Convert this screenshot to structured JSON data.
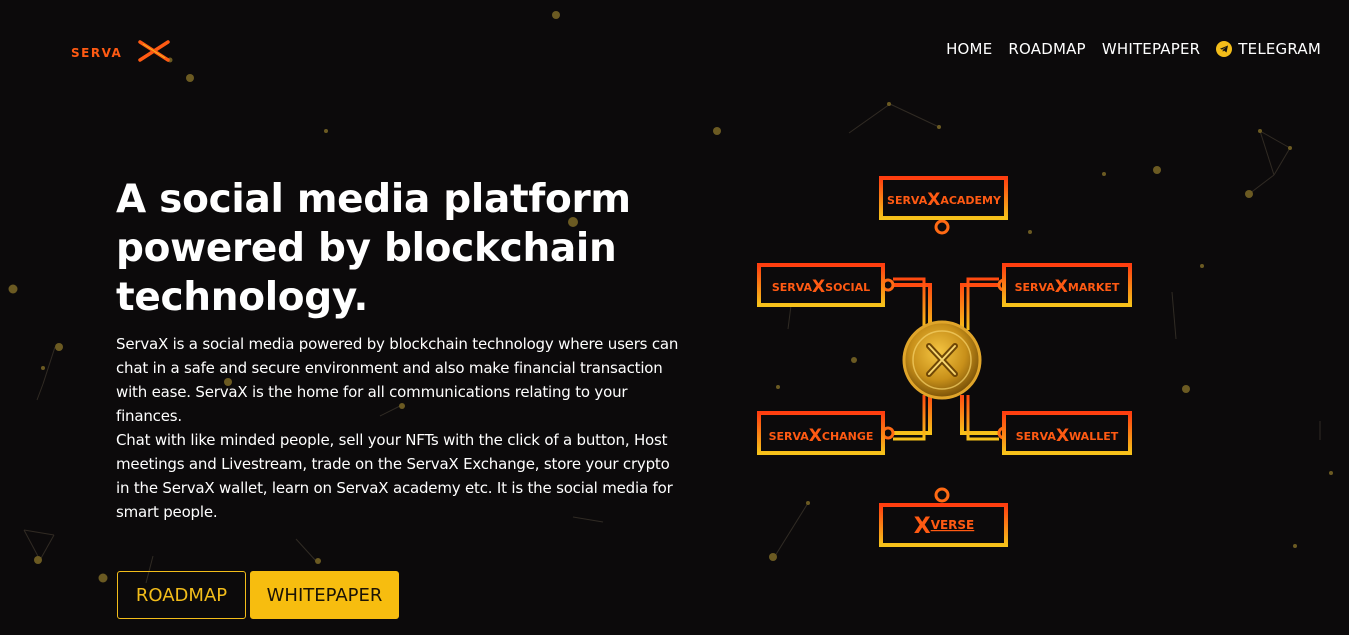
{
  "header": {
    "logo_text": "SERVAX",
    "nav": [
      {
        "label": "HOME"
      },
      {
        "label": "ROADMAP"
      },
      {
        "label": "WHITEPAPER"
      },
      {
        "label": "TELEGRAM",
        "icon": "telegram-icon"
      }
    ]
  },
  "hero": {
    "title": "A social media platform powered by blockchain technology.",
    "paragraph1": "ServaX is a social media powered by blockchain technology where users can chat in a safe and secure environment and also make financial transaction with ease. ServaX is the home for all communications relating to your finances.",
    "paragraph2": "Chat with like minded people, sell your NFTs with the click of a button, Host meetings and Livestream, trade on the ServaX Exchange, store your crypto in the ServaX wallet, learn on ServaX academy etc. It is the social media for smart people.",
    "buttons": {
      "roadmap": "ROADMAP",
      "whitepaper": "WHITEPAPER"
    }
  },
  "ecosystem": {
    "center_icon": "servax-coin-icon",
    "nodes": [
      {
        "prefix": "SERVA",
        "x": "X",
        "suffix": "ACADEMY"
      },
      {
        "prefix": "SERVA",
        "x": "X",
        "suffix": "SOCIAL"
      },
      {
        "prefix": "SERVA",
        "x": "X",
        "suffix": "MARKET"
      },
      {
        "prefix": "SERVA",
        "x": "X",
        "suffix": "CHANGE"
      },
      {
        "prefix": "SERVA",
        "x": "X",
        "suffix": "WALLET"
      },
      {
        "prefix": "",
        "x": "X",
        "suffix": "VERSE"
      }
    ]
  },
  "colors": {
    "background": "#0c0a0b",
    "accent": "#f7bd0f",
    "orange": "#ff5a13",
    "text": "#ffffff"
  }
}
